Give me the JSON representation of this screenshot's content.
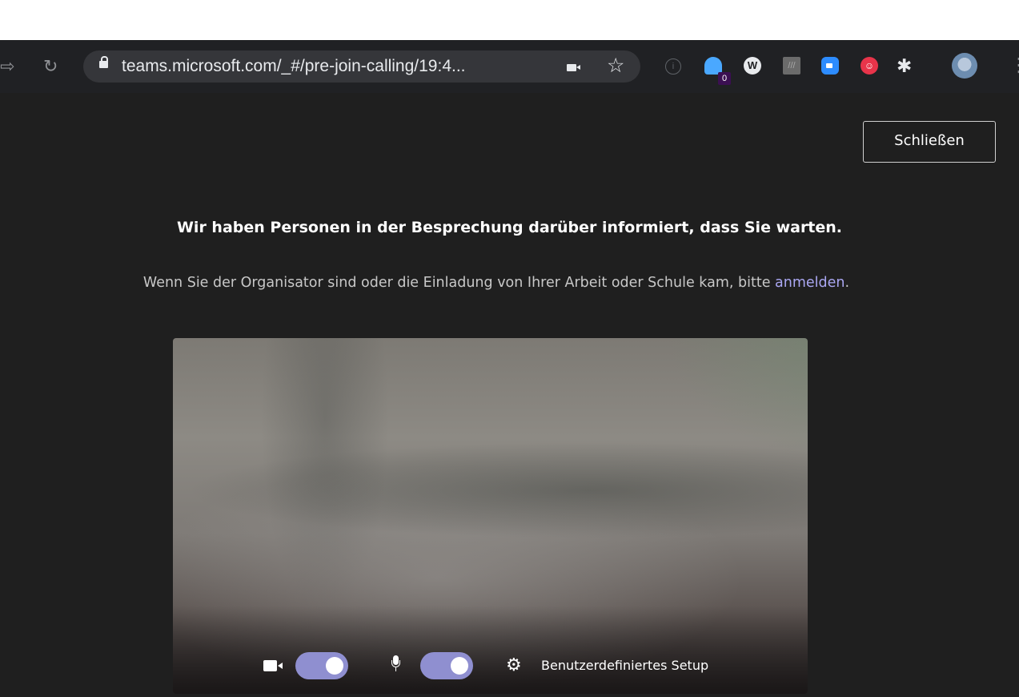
{
  "browser": {
    "url": "teams.microsoft.com/_#/pre-join-calling/19:4...",
    "extension_badge": "0",
    "extension_w": "W"
  },
  "header": {
    "close_label": "Schließen"
  },
  "main": {
    "headline": "Wir haben Personen in der Besprechung darüber informiert, dass Sie warten.",
    "subline_text": "Wenn Sie der Organisator sind oder die Einladung von Ihrer Arbeit oder Schule kam, bitte ",
    "subline_link": "anmelden",
    "subline_end": "."
  },
  "controls": {
    "camera_on": true,
    "mic_on": true,
    "setup_label": "Benutzerdefiniertes Setup"
  },
  "colors": {
    "page_background": "#1f1f1f",
    "toggle_on": "#8f8fd0",
    "link": "#aaa7f2"
  }
}
